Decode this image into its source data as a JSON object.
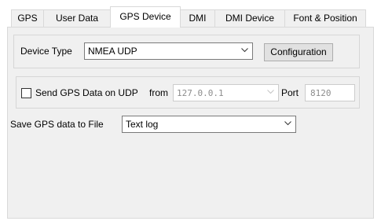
{
  "tabs": [
    {
      "label": "GPS"
    },
    {
      "label": "User Data"
    },
    {
      "label": "GPS Device"
    },
    {
      "label": "DMI"
    },
    {
      "label": "DMI Device"
    },
    {
      "label": "Font & Position"
    }
  ],
  "device": {
    "type_label": "Device Type",
    "type_value": "NMEA UDP",
    "configuration_label": "Configuration"
  },
  "udp": {
    "send_label": "Send GPS Data on UDP",
    "send_checked": false,
    "from_label": "from",
    "from_value": "127.0.0.1",
    "port_label": "Port",
    "port_value": "8120"
  },
  "save": {
    "label": "Save GPS data to File",
    "value": "Text log"
  }
}
